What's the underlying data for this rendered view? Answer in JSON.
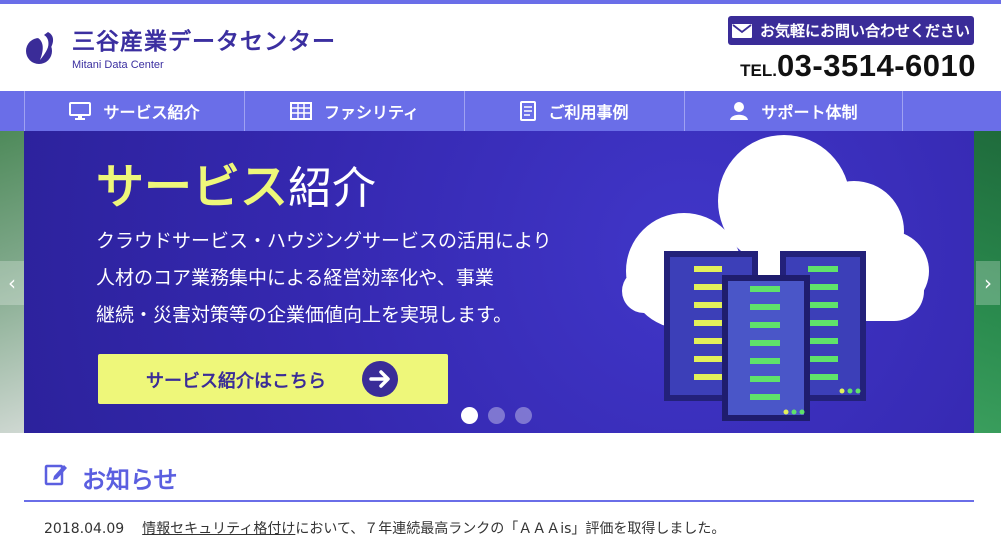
{
  "header": {
    "logo_ja": "三谷産業データセンター",
    "logo_en": "Mitani Data Center",
    "contact_label": "お気軽にお問い合わせください",
    "tel_prefix": "TEL.",
    "tel_number": "03-3514-6010"
  },
  "nav": [
    {
      "label": "サービス紹介",
      "icon": "monitor-icon"
    },
    {
      "label": "ファシリティ",
      "icon": "grid-icon"
    },
    {
      "label": "ご利用事例",
      "icon": "document-icon"
    },
    {
      "label": "サポート体制",
      "icon": "person-icon"
    }
  ],
  "hero": {
    "title_accent": "サービス",
    "title_rest": "紹介",
    "description": "クラウドサービス・ハウジングサービスの活用により\n人材のコア業務集中による経営効率化や、事業\n継続・災害対策等の企業価値向上を実現します。",
    "cta_label": "サービス紹介はこちら",
    "slide_count": 3,
    "active_slide": 1
  },
  "news": {
    "title": "お知らせ",
    "items": [
      {
        "date": "2018.04.09",
        "link_text": "情報セキュリティ格付け",
        "text": "において、７年連続最高ランクの「ＡＡＡis」評価を取得しました。"
      }
    ]
  },
  "colors": {
    "brand": "#3a2c98",
    "nav": "#6a6ee8",
    "accent": "#eef77a"
  }
}
